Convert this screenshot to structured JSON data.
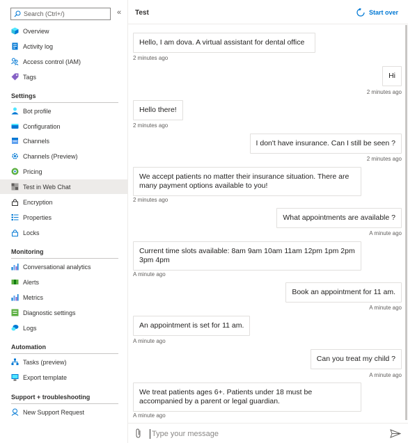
{
  "sidebar": {
    "search_placeholder": "Search (Ctrl+/)",
    "collapse_glyph": "«",
    "top_items": [
      {
        "label": "Overview",
        "icon": "cube-icon"
      },
      {
        "label": "Activity log",
        "icon": "log-icon"
      },
      {
        "label": "Access control (IAM)",
        "icon": "people-icon"
      },
      {
        "label": "Tags",
        "icon": "tag-icon"
      }
    ],
    "sections": [
      {
        "title": "Settings",
        "items": [
          {
            "label": "Bot profile",
            "icon": "bot-icon"
          },
          {
            "label": "Configuration",
            "icon": "configuration-icon"
          },
          {
            "label": "Channels",
            "icon": "channels-icon"
          },
          {
            "label": "Channels (Preview)",
            "icon": "gear-icon"
          },
          {
            "label": "Pricing",
            "icon": "pricing-icon"
          },
          {
            "label": "Test in Web Chat",
            "icon": "webchat-icon",
            "selected": true
          },
          {
            "label": "Encryption",
            "icon": "lock-icon"
          },
          {
            "label": "Properties",
            "icon": "properties-icon"
          },
          {
            "label": "Locks",
            "icon": "lock-icon"
          }
        ]
      },
      {
        "title": "Monitoring",
        "items": [
          {
            "label": "Conversational analytics",
            "icon": "chart-icon"
          },
          {
            "label": "Alerts",
            "icon": "alert-icon"
          },
          {
            "label": "Metrics",
            "icon": "chart-icon"
          },
          {
            "label": "Diagnostic settings",
            "icon": "diagnostic-icon"
          },
          {
            "label": "Logs",
            "icon": "logs-icon"
          }
        ]
      },
      {
        "title": "Automation",
        "items": [
          {
            "label": "Tasks (preview)",
            "icon": "tasks-icon"
          },
          {
            "label": "Export template",
            "icon": "export-icon"
          }
        ]
      },
      {
        "title": "Support + troubleshooting",
        "items": [
          {
            "label": "New Support Request",
            "icon": "support-icon"
          }
        ]
      }
    ]
  },
  "chat": {
    "title": "Test",
    "start_over_label": "Start over",
    "input_placeholder": "Type your message",
    "messages": [
      {
        "from": "bot",
        "text": "Hello, I am dova. A virtual assistant for dental office",
        "time": "2 minutes ago"
      },
      {
        "from": "user",
        "text": "Hi",
        "time": "2 minutes ago"
      },
      {
        "from": "bot",
        "text": "Hello there!",
        "time": "2 minutes ago"
      },
      {
        "from": "user",
        "text": "I don't have insurance. Can I still be seen ?",
        "time": "2 minutes ago"
      },
      {
        "from": "bot",
        "text": "We accept patients no matter their insurance situation. There are many payment options available to you!",
        "time": "2 minutes ago"
      },
      {
        "from": "user",
        "text": "What appointments are available ?",
        "time": "A minute ago"
      },
      {
        "from": "bot",
        "text": "Current time slots available: 8am 9am 10am 11am 12pm 1pm 2pm 3pm 4pm",
        "time": "A minute ago"
      },
      {
        "from": "user",
        "text": "Book an appointment for 11 am.",
        "time": "A minute ago"
      },
      {
        "from": "bot",
        "text": "An appointment is set for 11 am.",
        "time": "A minute ago"
      },
      {
        "from": "user",
        "text": "Can you treat my child ?",
        "time": "A minute ago"
      },
      {
        "from": "bot",
        "text": "We treat patients ages 6+. Patients under 18 must be accompanied by a parent or legal guardian.",
        "time": "A minute ago"
      }
    ]
  }
}
